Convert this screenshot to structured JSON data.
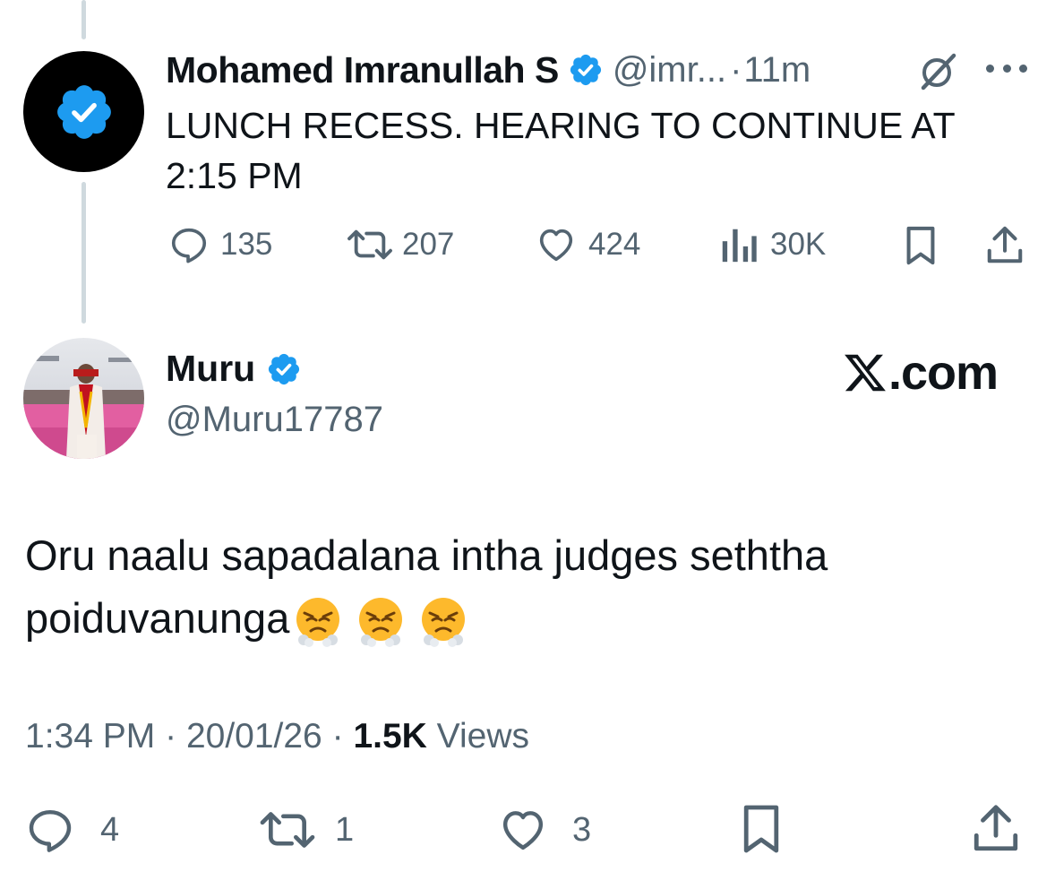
{
  "parent_tweet": {
    "author_name": "Mohamed Imranullah S",
    "handle": "@imr...",
    "separator": "·",
    "time": "11m",
    "text": "LUNCH RECESS. HEARING TO CONTINUE AT 2:15 PM",
    "icons": {
      "verified": "verified-badge-icon",
      "grok": "grok-icon",
      "more": "more-icon"
    },
    "actions": {
      "replies": "135",
      "reposts": "207",
      "likes": "424",
      "views": "30K"
    }
  },
  "reply_tweet": {
    "author_name": "Muru",
    "handle": "@Muru17787",
    "text": "Oru naalu sapadalana intha judges seththa poiduvanunga",
    "emojis": [
      "steam-from-nose-face",
      "steam-from-nose-face",
      "steam-from-nose-face"
    ],
    "time": "1:34 PM",
    "date": "20/01/26",
    "separator": "·",
    "views_count": "1.5K",
    "views_label": "Views",
    "actions": {
      "replies": "4",
      "reposts": "1",
      "likes": "3"
    }
  },
  "watermark": {
    "text": ".com",
    "logo": "x-logo-icon"
  },
  "colors": {
    "text_primary": "#0f1419",
    "text_secondary": "#536471",
    "verified_blue": "#1d9bf0",
    "thread_line": "#cfd9de"
  }
}
